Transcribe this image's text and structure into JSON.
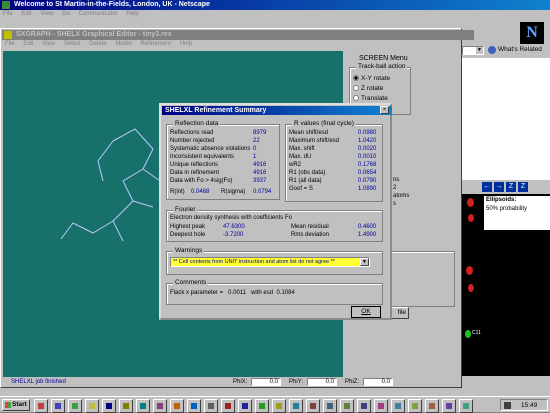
{
  "netscape": {
    "title": "Welcome to St Martin-in-the-Fields, London, UK - Netscape",
    "menu": [
      "File",
      "Edit",
      "View",
      "Go",
      "Communicator",
      "Help"
    ],
    "whats_related": "What's Related"
  },
  "sxgraph": {
    "title": "SXGRAPH - SHELX Graphical Editor - tiny3.res",
    "menu": [
      "File",
      "Edit",
      "View",
      "Select",
      "Delete",
      "Model",
      "Refinement",
      "Help"
    ],
    "status_text": "SHELXL job finished",
    "phix_label": "PhiX:",
    "phix_value": "0.0",
    "phiy_label": "PhiY:",
    "phiy_value": "0.0",
    "phiz_label": "PhiZ:",
    "phiz_value": "0.0"
  },
  "screen_menu": {
    "title": "SCREEN Menu",
    "trackball_label": "Track-ball action",
    "options": [
      "X-Y rotate",
      "Z rotate",
      "Translate"
    ],
    "selected": 0,
    "partial_labels": [
      "ns",
      "2",
      "atoms",
      "s"
    ],
    "file_button_partial": "file"
  },
  "dialog": {
    "title": "SHELXL Refinement Summary",
    "reflection": {
      "title": "Reflection data",
      "rows": [
        {
          "label": "Reflections read",
          "value": "8979"
        },
        {
          "label": "Number rejected",
          "value": "22"
        },
        {
          "label": "Systematic absence violations",
          "value": "0"
        },
        {
          "label": "Inconsistent equivalents",
          "value": "1"
        },
        {
          "label": "Unique reflections",
          "value": "4916"
        },
        {
          "label": "Data in refinement",
          "value": "4916"
        },
        {
          "label": "Data with Fo > 4sig(Fo)",
          "value": "3937"
        }
      ],
      "rint_label": "R(int)",
      "rint_value": "0.0468",
      "rsigma_label": "R(sigma)",
      "rsigma_value": "0.0794"
    },
    "rvalues": {
      "title": "R values (final cycle)",
      "rows": [
        {
          "label": "Mean shift/esd",
          "value": "0.0980"
        },
        {
          "label": "Maximum shift/esd",
          "value": "1.0420"
        },
        {
          "label": "Max. shift",
          "value": "0.0020"
        },
        {
          "label": "Max. dU",
          "value": "0.0010"
        },
        {
          "label": "wR2",
          "value": "0.1768"
        },
        {
          "label": "R1 (obs data)",
          "value": "0.0654"
        },
        {
          "label": "R1 (all data)",
          "value": "0.0790"
        },
        {
          "label": "Goof = S",
          "value": "1.0890"
        }
      ]
    },
    "fourier": {
      "title": "Fourier",
      "desc": "Electron density synthesis with coefficients Fo",
      "highest_label": "Highest peak",
      "highest_value": "47.6300",
      "deepest_label": "Deepest hole",
      "deepest_value": "-3.7200",
      "mean_label": "Mean residual",
      "mean_value": "0.4600",
      "rms_label": "Rms deviation",
      "rms_value": "1.4900"
    },
    "warnings": {
      "title": "Warnings",
      "selected": "** Cell contents from UNIT instruction and atom list do not agree **"
    },
    "comments": {
      "title": "Comments",
      "text": "Flack x parameter =   0.0011   with esd  0.1084"
    },
    "ok_label": "OK"
  },
  "right_panel": {
    "ellipsoids_label": "Ellipsoids:",
    "probability": "50% probability",
    "atom_label": "C11"
  },
  "taskbar": {
    "start_label": "Start",
    "clock": "15:49"
  },
  "colors": {
    "title_active": "#000080",
    "molecule_bg": "#18706a",
    "warning_bg": "#ffff33"
  }
}
